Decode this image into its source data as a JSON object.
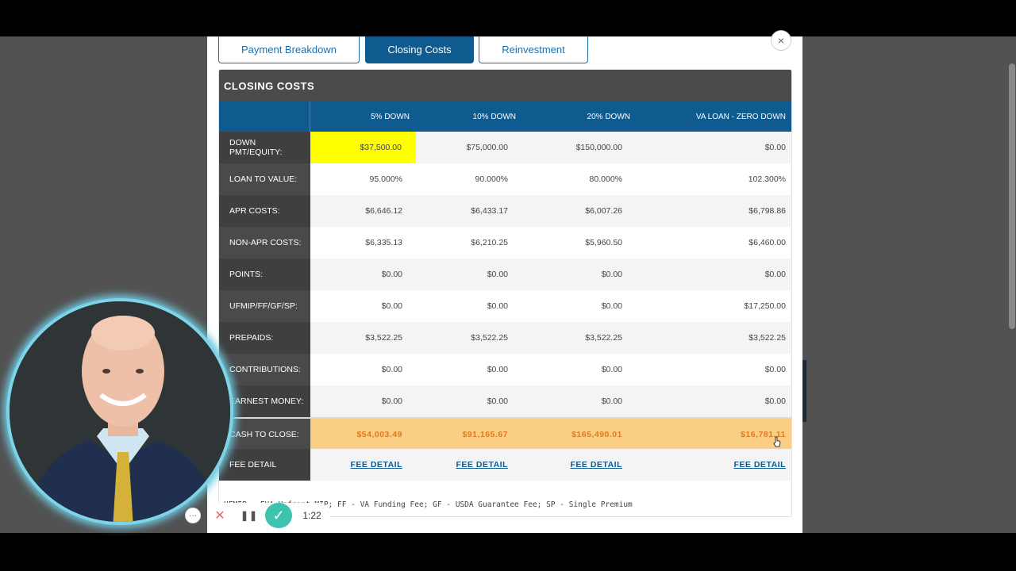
{
  "tabs": [
    {
      "label": "Payment Breakdown",
      "active": false
    },
    {
      "label": "Closing Costs",
      "active": true
    },
    {
      "label": "Reinvestment",
      "active": false
    }
  ],
  "close_label": "×",
  "panel": {
    "title": "CLOSING COSTS",
    "columns": [
      "5% DOWN",
      "10% DOWN",
      "20% DOWN",
      "VA LOAN - ZERO DOWN"
    ],
    "rows": [
      {
        "label": "DOWN PMT/EQUITY:",
        "values": [
          "$37,500.00",
          "$75,000.00",
          "$150,000.00",
          "$0.00"
        ]
      },
      {
        "label": "LOAN TO VALUE:",
        "values": [
          "95.000%",
          "90.000%",
          "80.000%",
          "102.300%"
        ]
      },
      {
        "label": "APR COSTS:",
        "values": [
          "$6,646.12",
          "$6,433.17",
          "$6,007.26",
          "$6,798.86"
        ]
      },
      {
        "label": "NON-APR COSTS:",
        "values": [
          "$6,335.13",
          "$6,210.25",
          "$5,960.50",
          "$6,460.00"
        ]
      },
      {
        "label": "POINTS:",
        "values": [
          "$0.00",
          "$0.00",
          "$0.00",
          "$0.00"
        ]
      },
      {
        "label": "UFMIP/FF/GF/SP:",
        "values": [
          "$0.00",
          "$0.00",
          "$0.00",
          "$17,250.00"
        ]
      },
      {
        "label": "PREPAIDS:",
        "values": [
          "$3,522.25",
          "$3,522.25",
          "$3,522.25",
          "$3,522.25"
        ]
      },
      {
        "label": "CONTRIBUTIONS:",
        "values": [
          "$0.00",
          "$0.00",
          "$0.00",
          "$0.00"
        ]
      },
      {
        "label": "EARNEST MONEY:",
        "values": [
          "$0.00",
          "$0.00",
          "$0.00",
          "$0.00"
        ]
      }
    ],
    "total_row": {
      "label": "CASH TO CLOSE:",
      "values": [
        "$54,003.49",
        "$91,165.67",
        "$165,490.01",
        "$16,781.11"
      ]
    },
    "fee_row": {
      "label": "FEE DETAIL",
      "values": [
        "FEE DETAIL",
        "FEE DETAIL",
        "FEE DETAIL",
        "FEE DETAIL"
      ]
    },
    "footnote": "UFMIP - FHA Upfront MIP; FF - VA Funding Fee; GF - USDA Guarantee Fee; SP - Single Premium",
    "highlight_color": "#ffff00",
    "total_row_color": "#f9cf85"
  },
  "recorder": {
    "more_label": "···",
    "cancel_label": "✕",
    "pause_label": "❚❚",
    "done_label": "✓",
    "timer": "1:22"
  }
}
